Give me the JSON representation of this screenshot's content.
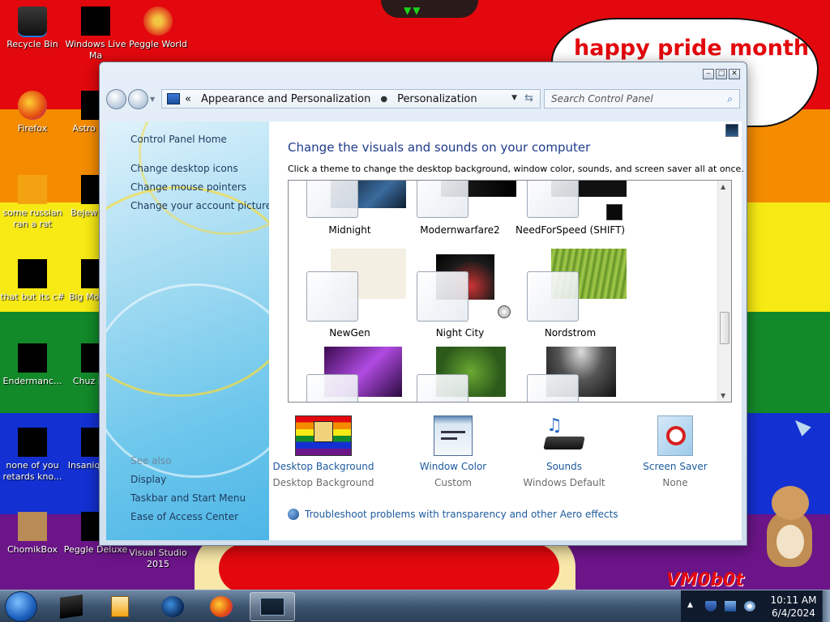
{
  "desktop": {
    "speech_text": "happy pride month",
    "vm_tag": "VM0b0t",
    "icons": [
      {
        "label": "Recycle Bin"
      },
      {
        "label": "Windows Live Ma"
      },
      {
        "label": "Peggle World"
      },
      {
        "label": "Firefox"
      },
      {
        "label": "Astro Delu"
      },
      {
        "label": "some russian ran a rat"
      },
      {
        "label": "Bejew Delu"
      },
      {
        "label": "that but its c#"
      },
      {
        "label": "Big Mo Delu"
      },
      {
        "label": "Endermanc..."
      },
      {
        "label": "Chuz Delu"
      },
      {
        "label": "none of you retards kno..."
      },
      {
        "label": "Insaniq Delu"
      },
      {
        "label": "ChomikBox"
      },
      {
        "label": "Peggle Deluxe"
      },
      {
        "label": "Visual Studio 2015"
      }
    ],
    "colors": {
      "red": "#e3080d",
      "orange": "#f58c00",
      "yellow": "#f7ea14",
      "green": "#138a2a",
      "blue": "#1330d2",
      "purple": "#6c1589"
    }
  },
  "window": {
    "controls": [
      "minimize-icon",
      "maximize-icon",
      "close-icon"
    ],
    "breadcrumb": {
      "overflow": "«",
      "items": [
        "Appearance and Personalization",
        "Personalization"
      ],
      "separator": "►"
    },
    "search_placeholder": "Search Control Panel",
    "nav": {
      "links": [
        "Control Panel Home",
        "Change desktop icons",
        "Change mouse pointers",
        "Change your account picture"
      ],
      "see_also_label": "See also",
      "see_also": [
        "Display",
        "Taskbar and Start Menu",
        "Ease of Access Center"
      ]
    },
    "main": {
      "title": "Change the visuals and sounds on your computer",
      "subtitle": "Click a theme to change the desktop background, window color, sounds, and screen saver all at once.",
      "themes": [
        {
          "name": "Midnight",
          "icon": "dark-wallpaper"
        },
        {
          "name": "Modernwarfare2",
          "icon": "dark-wallpaper"
        },
        {
          "name": "NeedForSpeed (SHIFT)",
          "icon": "dark-wallpaper"
        },
        {
          "name": "NewGen",
          "icon": "light-wallpaper"
        },
        {
          "name": "Night City",
          "icon": "city-wallpaper"
        },
        {
          "name": "Nordstrom",
          "icon": "green-wallpaper"
        },
        {
          "name": "",
          "icon": "purple-wallpaper"
        },
        {
          "name": "",
          "icon": "leaf-wallpaper"
        },
        {
          "name": "",
          "icon": "spotlight-wallpaper"
        }
      ],
      "settings": [
        {
          "label": "Desktop Background",
          "value": "Desktop Background",
          "icon": "desktop-background-icon"
        },
        {
          "label": "Window Color",
          "value": "Custom",
          "icon": "window-color-icon"
        },
        {
          "label": "Sounds",
          "value": "Windows Default",
          "icon": "sounds-icon"
        },
        {
          "label": "Screen Saver",
          "value": "None",
          "icon": "screen-saver-icon"
        }
      ],
      "troubleshoot": "Troubleshoot problems with transparency and other Aero effects"
    }
  },
  "taskbar": {
    "apps": [
      "app-icon",
      "media-player-icon",
      "globe-icon",
      "firefox-icon",
      "control-panel-icon"
    ],
    "clock_time": "10:11 AM",
    "clock_date": "6/4/2024"
  }
}
